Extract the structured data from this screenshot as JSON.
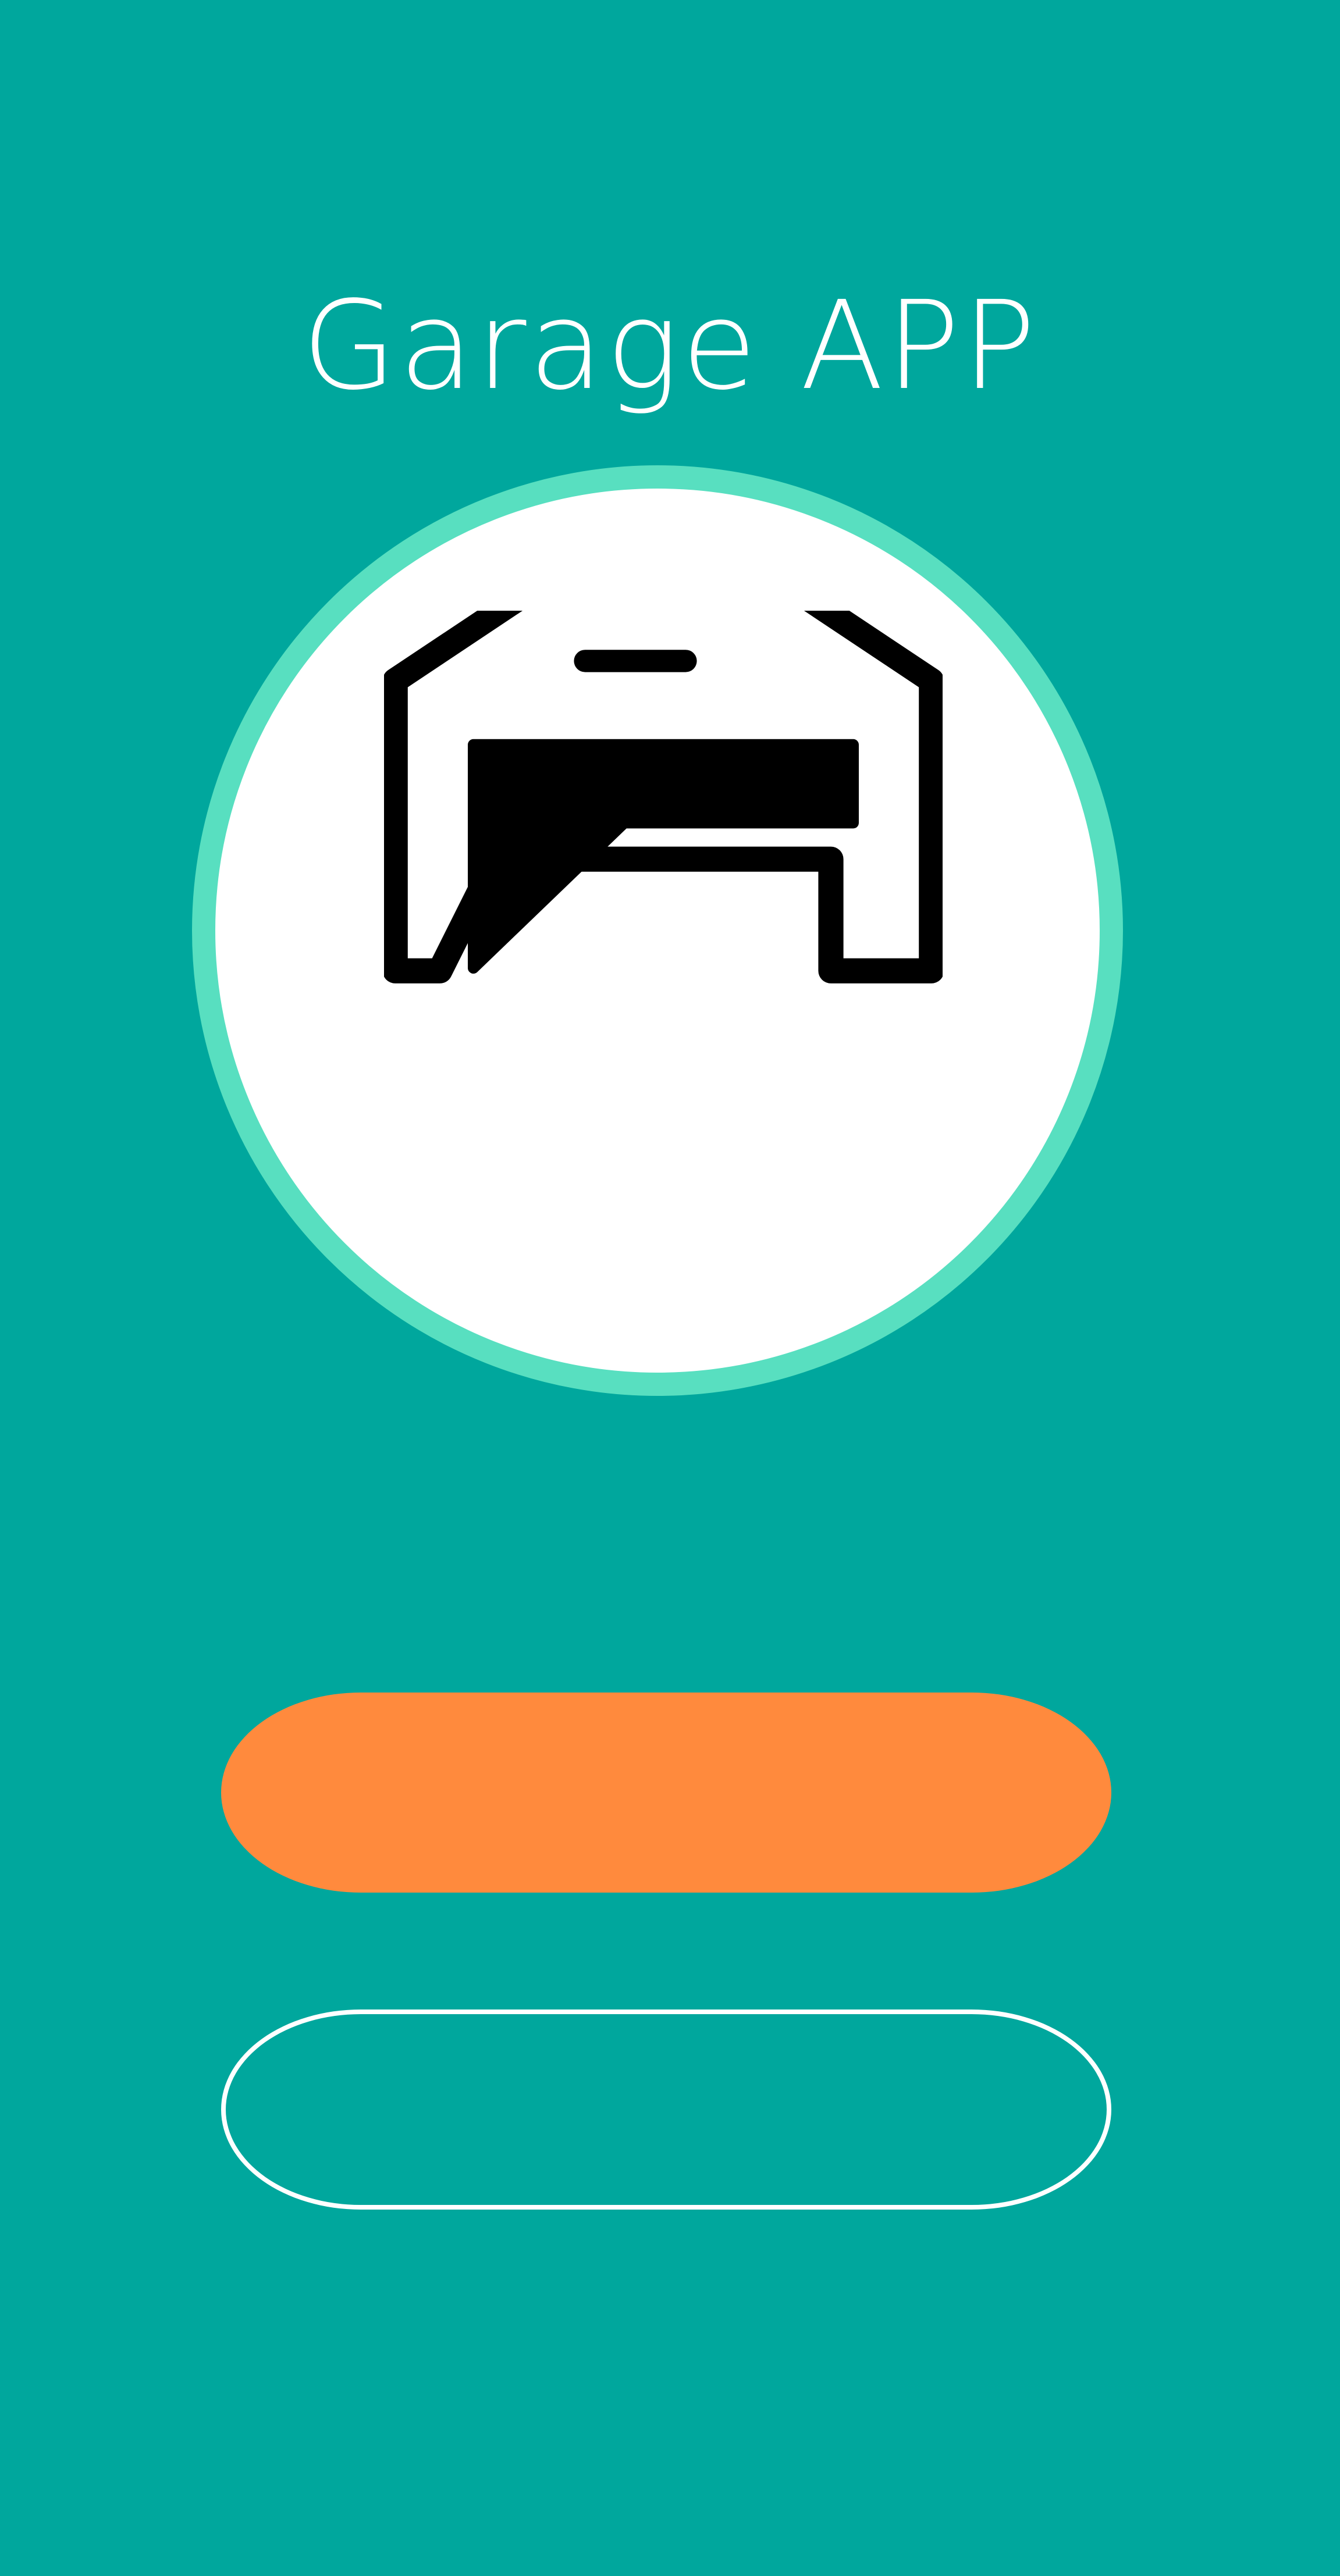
{
  "app": {
    "title": "Garage APP"
  },
  "logo": {
    "icon": "garage-icon"
  },
  "buttons": {
    "primary_label": "",
    "secondary_label": ""
  },
  "colors": {
    "background": "#00a79d",
    "ring": "#58dfc0",
    "primary_button": "#ff8a3d",
    "secondary_button_border": "#ffffff",
    "text": "#ffffff"
  }
}
